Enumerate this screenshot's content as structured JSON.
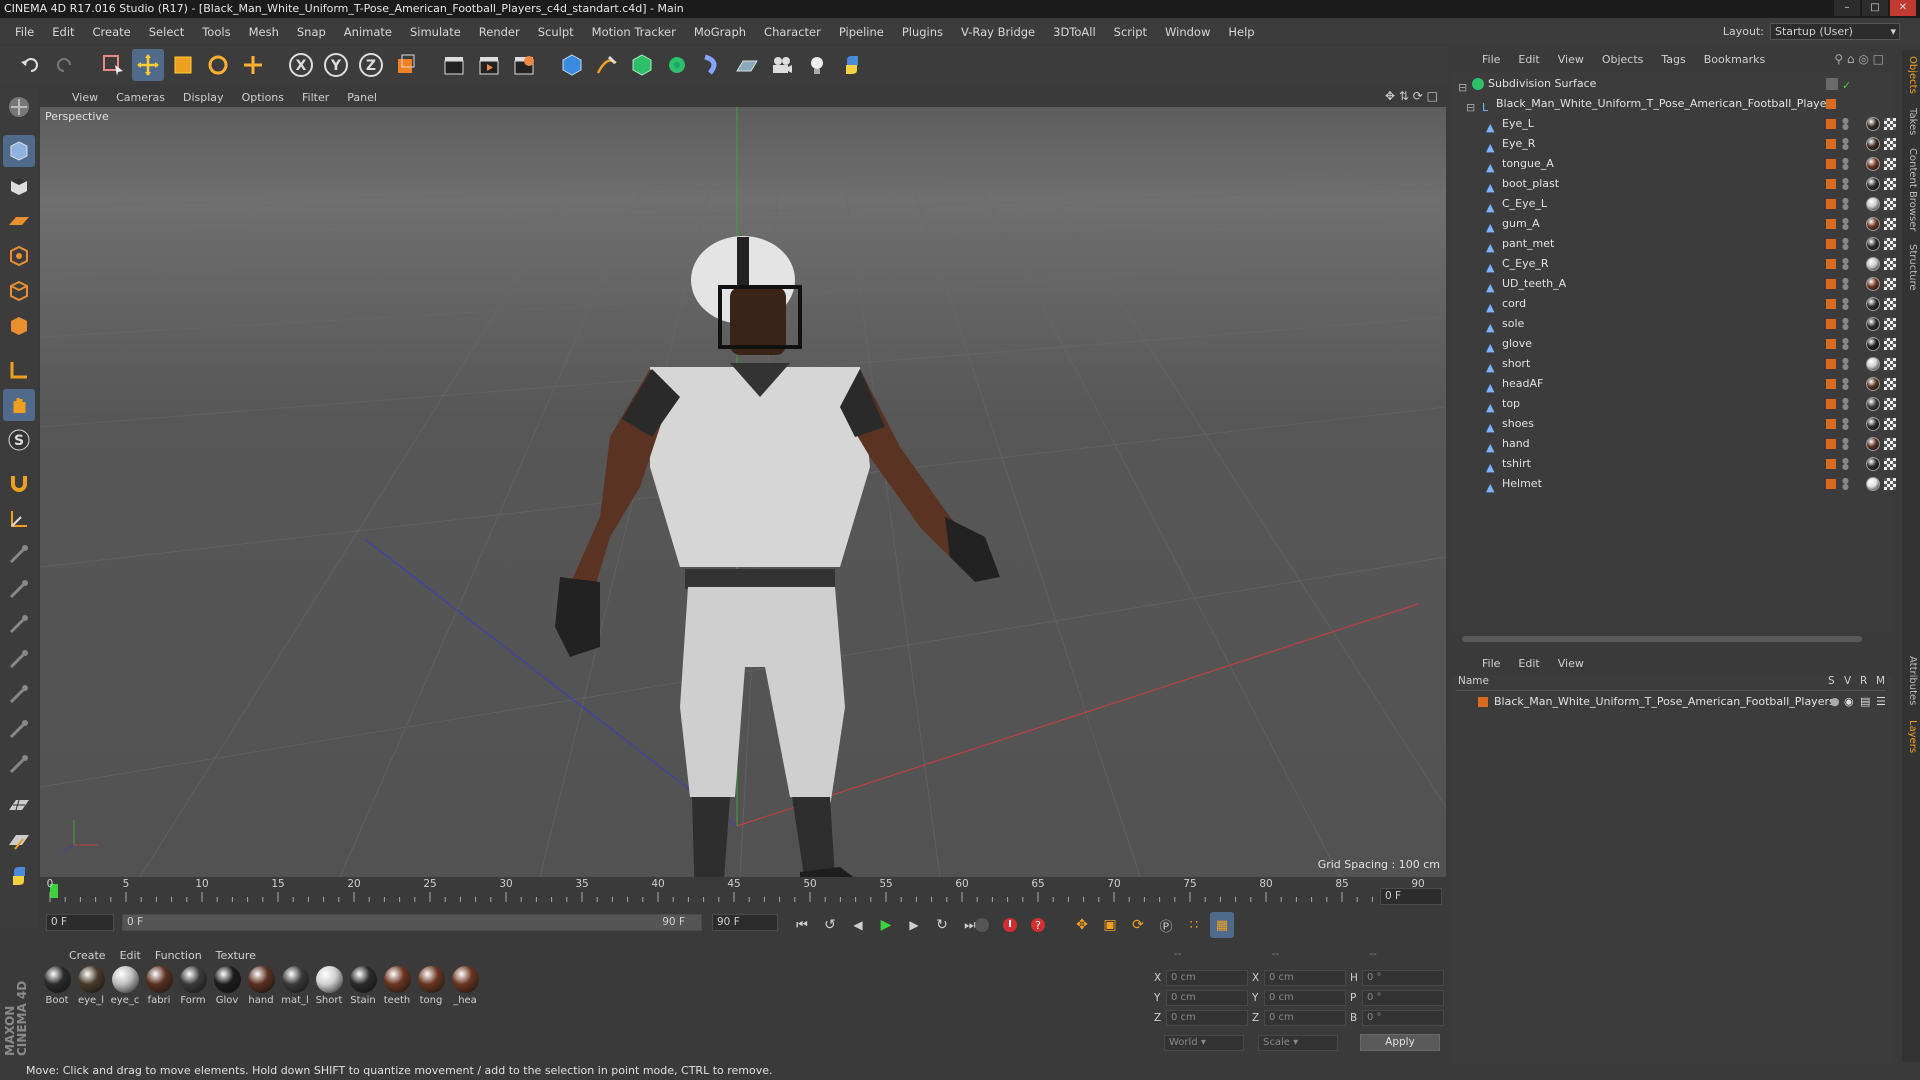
{
  "window": {
    "title": "CINEMA 4D R17.016 Studio (R17) - [Black_Man_White_Uniform_T-Pose_American_Football_Players_c4d_standart.c4d] - Main"
  },
  "menubar": {
    "items": [
      "File",
      "Edit",
      "Create",
      "Select",
      "Tools",
      "Mesh",
      "Snap",
      "Animate",
      "Simulate",
      "Render",
      "Sculpt",
      "Motion Tracker",
      "MoGraph",
      "Character",
      "Pipeline",
      "Plugins",
      "V-Ray Bridge",
      "3DToAll",
      "Script",
      "Window",
      "Help"
    ],
    "layout_label": "Layout:",
    "layout_value": "Startup (User)"
  },
  "viewport": {
    "menu": [
      "View",
      "Cameras",
      "Display",
      "Options",
      "Filter",
      "Panel"
    ],
    "camera_label": "Perspective",
    "grid_spacing": "Grid Spacing : 100 cm"
  },
  "timeline": {
    "ticks": [
      "0",
      "5",
      "10",
      "15",
      "20",
      "25",
      "30",
      "35",
      "40",
      "45",
      "50",
      "55",
      "60",
      "65",
      "70",
      "75",
      "80",
      "85",
      "90"
    ],
    "current_frame_right": "0 F",
    "start_field": "0 F",
    "range_start": "0 F",
    "range_end": "90 F",
    "end_field": "90 F"
  },
  "materials": {
    "menu": [
      "Create",
      "Edit",
      "Function",
      "Texture"
    ],
    "items": [
      {
        "label": "Boot",
        "color": "#2a2a2a"
      },
      {
        "label": "eye_l",
        "color": "#4a3a2a"
      },
      {
        "label": "eye_c",
        "color": "#bfbfbf"
      },
      {
        "label": "fabri",
        "color": "#5a3020"
      },
      {
        "label": "Form",
        "color": "#3a3a3a"
      },
      {
        "label": "Glov",
        "color": "#1c1c1c"
      },
      {
        "label": "hand",
        "color": "#5a3020"
      },
      {
        "label": "mat_l",
        "color": "#3a3a3a"
      },
      {
        "label": "Short",
        "color": "#d0d0d0"
      },
      {
        "label": "Stain",
        "color": "#2a2a2a"
      },
      {
        "label": "teeth",
        "color": "#6b3520"
      },
      {
        "label": "tong",
        "color": "#6b3520"
      },
      {
        "label": "_hea",
        "color": "#6b3520"
      }
    ]
  },
  "coordinates": {
    "header_dashes": [
      "--",
      "--",
      "--"
    ],
    "rows": [
      {
        "a": "X",
        "av": "0 cm",
        "b": "X",
        "bv": "0 cm",
        "c": "H",
        "cv": "0 °"
      },
      {
        "a": "Y",
        "av": "0 cm",
        "b": "Y",
        "bv": "0 cm",
        "c": "P",
        "cv": "0 °"
      },
      {
        "a": "Z",
        "av": "0 cm",
        "b": "Z",
        "bv": "0 cm",
        "c": "B",
        "cv": "0 °"
      }
    ],
    "space": "World",
    "mode": "Scale",
    "apply": "Apply"
  },
  "object_manager": {
    "menu": [
      "File",
      "Edit",
      "View",
      "Objects",
      "Tags",
      "Bookmarks"
    ],
    "root": "Subdivision Surface",
    "group": "Black_Man_White_Uniform_T_Pose_American_Football_Players",
    "children": [
      "Eye_L",
      "Eye_R",
      "tongue_A",
      "boot_plast",
      "C_Eye_L",
      "gum_A",
      "pant_met",
      "C_Eye_R",
      "UD_teeth_A",
      "cord",
      "sole",
      "glove",
      "short",
      "headAF",
      "top",
      "shoes",
      "hand",
      "tshirt",
      "Helmet"
    ]
  },
  "layer_manager": {
    "menu": [
      "File",
      "Edit",
      "View"
    ],
    "columns": [
      "Name",
      "S",
      "V",
      "R",
      "M"
    ],
    "rows": [
      "Black_Man_White_Uniform_T_Pose_American_Football_Players"
    ]
  },
  "side_tabs": [
    "Objects",
    "Takes",
    "Content Browser",
    "Structure",
    "Attributes",
    "Layers"
  ],
  "status": "Move: Click and drag to move elements. Hold down SHIFT to quantize movement / add to the selection in point mode, CTRL to remove.",
  "brand": "MAXON CINEMA 4D"
}
